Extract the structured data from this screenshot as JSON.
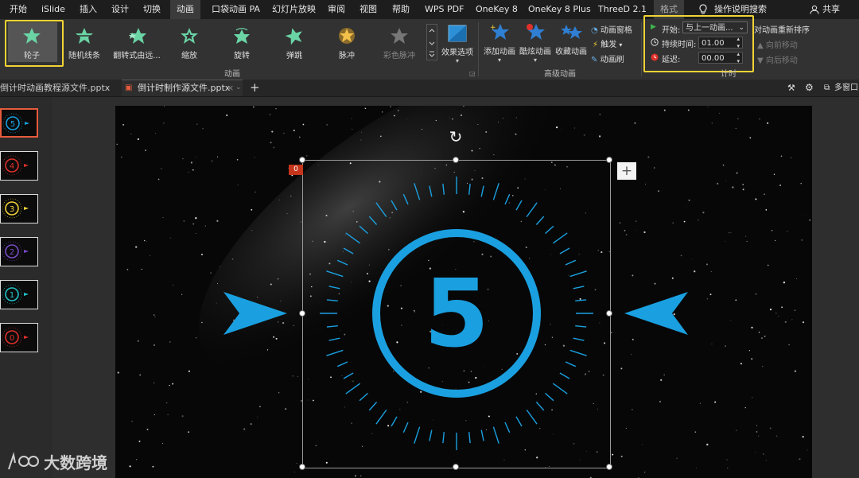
{
  "menu": {
    "items": [
      "开始",
      "iSlide",
      "插入",
      "设计",
      "切换",
      "动画",
      "口袋动画 PA",
      "幻灯片放映",
      "审阅",
      "视图",
      "帮助",
      "WPS PDF",
      "OneKey 8",
      "OneKey 8 Plus",
      "ThreeD 2.1",
      "格式"
    ],
    "search": "操作说明搜索",
    "share": "共享"
  },
  "ribbon": {
    "animations": [
      "轮子",
      "随机线条",
      "翻转式由远...",
      "缩放",
      "旋转",
      "弹跳",
      "脉冲",
      "彩色脉冲"
    ],
    "effect_options": "效果选项",
    "group_animation": "动画",
    "add_animation": "添加动画",
    "cool_animation": "酷炫动画",
    "collect_animation": "收藏动画",
    "animation_pane": "动画窗格",
    "trigger": "触发",
    "animation_painter": "动画刷",
    "group_advanced": "高级动画",
    "timing": {
      "start_label": "开始:",
      "start_value": "与上一动画...",
      "duration_label": "持续时间:",
      "duration_value": "01.00",
      "delay_label": "延迟:",
      "delay_value": "00.00",
      "reorder": "对动画重新排序",
      "move_earlier": "向前移动",
      "move_later": "向后移动",
      "group_label": "计时"
    }
  },
  "tabs": {
    "doc1": "倒计时动画教程源文件.pptx",
    "doc2": "倒计时制作源文件.pptx",
    "multiwindow": "多窗口"
  },
  "thumbnails": [
    {
      "number": "5",
      "color": "#1aa0e0"
    },
    {
      "number": "4",
      "color": "#e0302a"
    },
    {
      "number": "3",
      "color": "#f2d335"
    },
    {
      "number": "2",
      "color": "#7a4bc9"
    },
    {
      "number": "1",
      "color": "#21c4c8"
    },
    {
      "number": "0",
      "color": "#e0302a"
    }
  ],
  "slide": {
    "countdown_number": "5",
    "animation_badge": "0",
    "accent_color": "#1aa0e0"
  },
  "watermark": {
    "text": "大数跨境"
  }
}
